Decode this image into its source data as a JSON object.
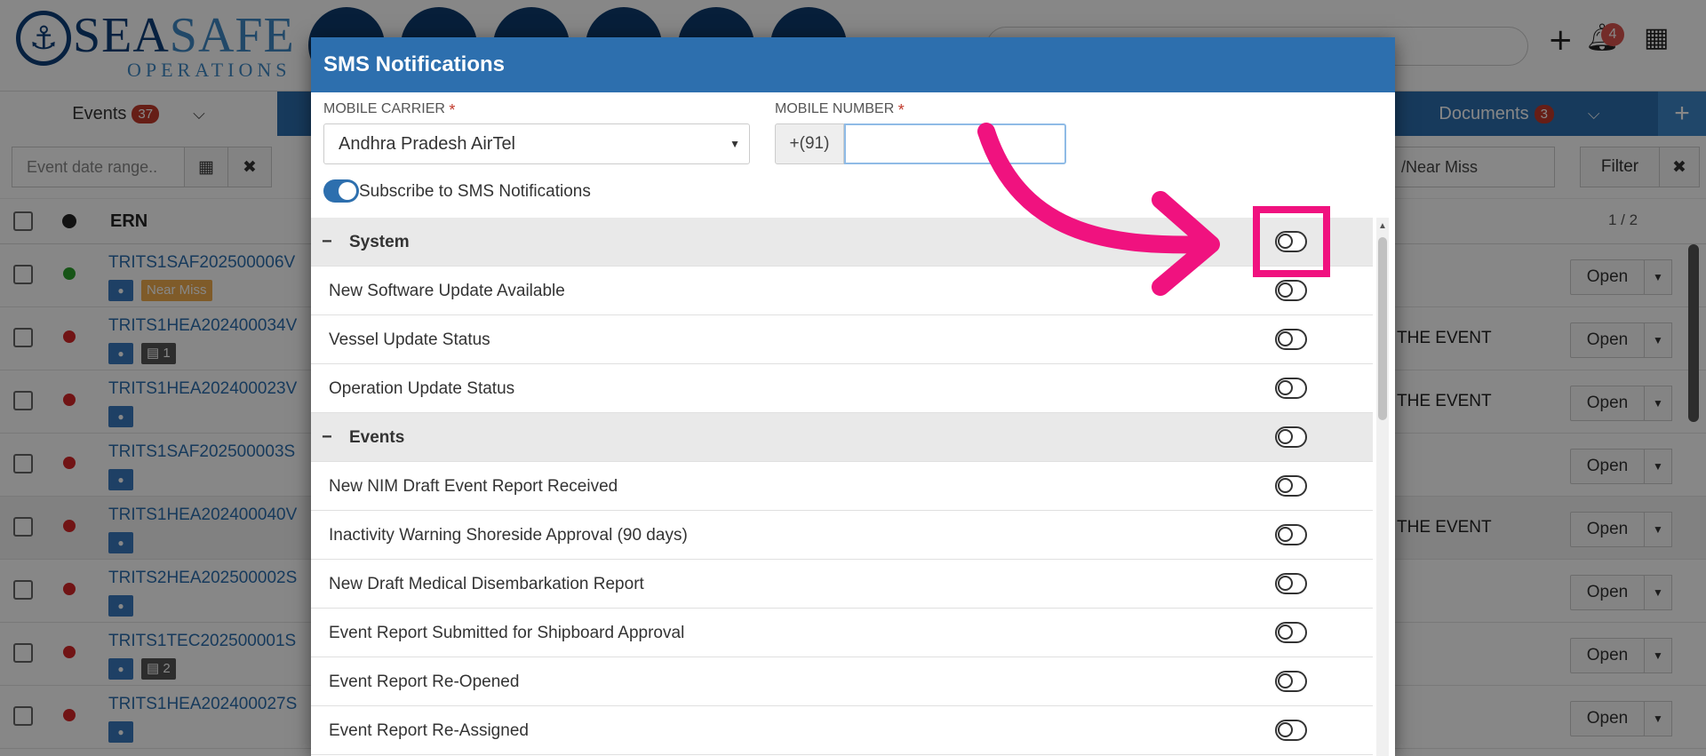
{
  "app": {
    "logo_word_1": "SEA",
    "logo_word_2": "SAFE",
    "logo_sub": "OPERATIONS",
    "bell_count": "4",
    "plus_icon": "plus-icon",
    "bell_icon": "bell-icon",
    "grid_icon": "grid-icon"
  },
  "tabs": {
    "events_label": "Events",
    "events_count": "37",
    "documents_label": "Documents",
    "documents_count": "3",
    "add_symbol": "+"
  },
  "filters": {
    "date_placeholder": "Event date range..",
    "type_value": "/Near Miss",
    "filter_label": "Filter",
    "clear_symbol": "✖",
    "pagination": "1 / 2"
  },
  "list": {
    "ern_header": "ERN",
    "rows": [
      {
        "ern": "TRITS1SAF202500006V",
        "status_color": "#2ca02c",
        "extra": "Near Miss",
        "desc": "",
        "open": "Open"
      },
      {
        "ern": "TRITS1HEA202400034V",
        "status_color": "#d62728",
        "extra": "1",
        "desc": "THE EVENT",
        "open": "Open"
      },
      {
        "ern": "TRITS1HEA202400023V",
        "status_color": "#d62728",
        "extra": "",
        "desc": "THE EVENT",
        "open": "Open"
      },
      {
        "ern": "TRITS1SAF202500003S",
        "status_color": "#d62728",
        "extra": "",
        "desc": "",
        "open": "Open"
      },
      {
        "ern": "TRITS1HEA202400040V",
        "status_color": "#d62728",
        "extra": "",
        "desc": "THE EVENT",
        "open": "Open"
      },
      {
        "ern": "TRITS2HEA202500002S",
        "status_color": "#d62728",
        "extra": "",
        "desc": "",
        "open": "Open"
      },
      {
        "ern": "TRITS1TEC202500001S",
        "status_color": "#d62728",
        "extra": "2",
        "desc": "",
        "open": "Open"
      },
      {
        "ern": "TRITS1HEA202400027S",
        "status_color": "#d62728",
        "extra": "",
        "desc": "",
        "open": "Open"
      }
    ]
  },
  "modal": {
    "title": "SMS Notifications",
    "carrier_label": "MOBILE CARRIER",
    "carrier_value": "Andhra Pradesh AirTel",
    "number_label": "MOBILE NUMBER",
    "country_code": "+(91)",
    "number_value": "",
    "required_mark": "*",
    "subscribe_label": "Subscribe to SMS Notifications",
    "subscribe_on": true,
    "collapse_symbol": "−",
    "items": [
      {
        "label": "System",
        "section": true
      },
      {
        "label": "New Software Update Available",
        "section": false
      },
      {
        "label": "Vessel Update Status",
        "section": false
      },
      {
        "label": "Operation Update Status",
        "section": false
      },
      {
        "label": "Events",
        "section": true
      },
      {
        "label": "New NIM Draft Event Report Received",
        "section": false
      },
      {
        "label": "Inactivity Warning Shoreside Approval (90 days)",
        "section": false
      },
      {
        "label": "New Draft Medical Disembarkation Report",
        "section": false
      },
      {
        "label": "Event Report Submitted for Shipboard Approval",
        "section": false
      },
      {
        "label": "Event Report Re-Opened",
        "section": false
      },
      {
        "label": "Event Report Re-Assigned",
        "section": false
      }
    ]
  },
  "colors": {
    "brand_blue": "#2d6fae",
    "annotation_pink": "#f0127f"
  }
}
